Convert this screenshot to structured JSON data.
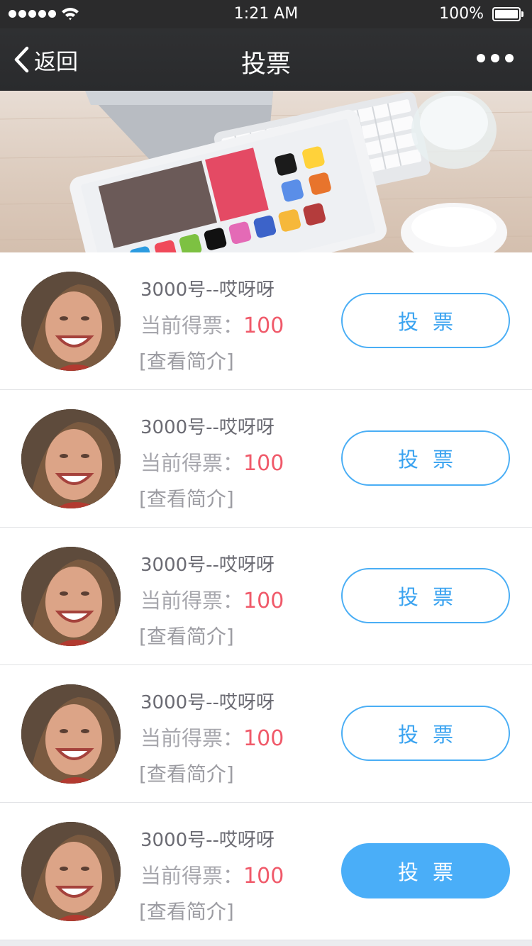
{
  "status_bar": {
    "time": "1:21 AM",
    "battery": "100%",
    "signal_icon": "signal-dots-icon",
    "wifi_icon": "wifi-icon",
    "battery_icon": "battery-icon"
  },
  "nav": {
    "back_label": "返回",
    "title": "投票",
    "back_icon": "chevron-left-icon",
    "more_icon": "more-dots-icon"
  },
  "banner": {
    "image": "desk-with-tablet-keyboard-mouse-and-glass"
  },
  "candidates": [
    {
      "name": "3000号--哎呀呀",
      "votes_label": "当前得票：",
      "votes": "100",
      "intro": "[查看简介]",
      "vote_label": "投票",
      "selected": false
    },
    {
      "name": "3000号--哎呀呀",
      "votes_label": "当前得票：",
      "votes": "100",
      "intro": "[查看简介]",
      "vote_label": "投票",
      "selected": false
    },
    {
      "name": "3000号--哎呀呀",
      "votes_label": "当前得票：",
      "votes": "100",
      "intro": "[查看简介]",
      "vote_label": "投票",
      "selected": false
    },
    {
      "name": "3000号--哎呀呀",
      "votes_label": "当前得票：",
      "votes": "100",
      "intro": "[查看简介]",
      "vote_label": "投票",
      "selected": false
    },
    {
      "name": "3000号--哎呀呀",
      "votes_label": "当前得票：",
      "votes": "100",
      "intro": "[查看简介]",
      "vote_label": "投票",
      "selected": true
    }
  ],
  "colors": {
    "accent": "#4aaef5",
    "vote_count": "#f05a6a",
    "nav_background": "#2b2b2c"
  }
}
